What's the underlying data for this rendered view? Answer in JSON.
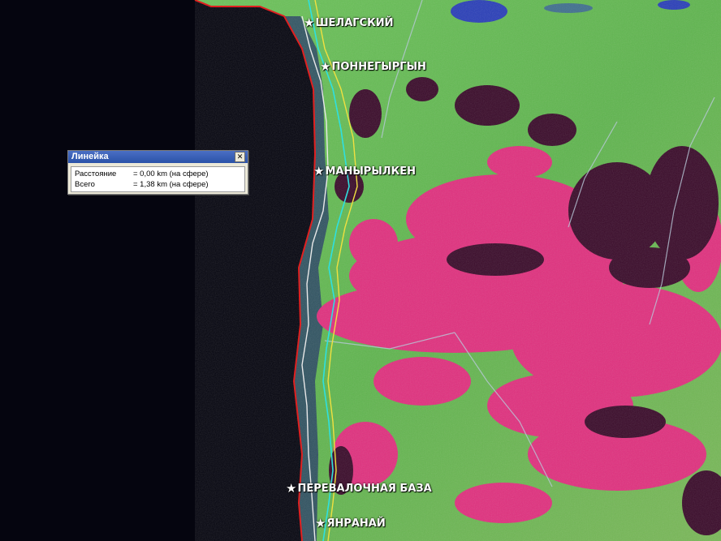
{
  "places": [
    {
      "name": "ШЕЛАГСКИЙ",
      "icon": "star-icon"
    },
    {
      "name": "ПОННЕГЫРГЫН",
      "icon": "star-icon"
    },
    {
      "name": "МАНЫРЫЛКЕН",
      "icon": "star-icon"
    },
    {
      "name": "ПЕРЕВАЛОЧНАЯ БАЗА",
      "icon": "star-icon"
    },
    {
      "name": "ЯНРАНАЙ",
      "icon": "star-icon"
    }
  ],
  "ruler": {
    "title": "Линейка",
    "close_icon": "close-icon",
    "rows": [
      {
        "label": "Расстояние",
        "value": "= 0,00 km (на сфере)"
      },
      {
        "label": "Всего",
        "value": "= 1,38 km (на сфере)"
      }
    ]
  },
  "colors": {
    "sea": "#05050f",
    "vegetation": "#5ec24a",
    "bare_ground": "#e0307e",
    "shadow": "#3a0b2a",
    "water": "#2a3fb8",
    "route_line": "#e8e8e8",
    "coast_line": "#e02020"
  }
}
